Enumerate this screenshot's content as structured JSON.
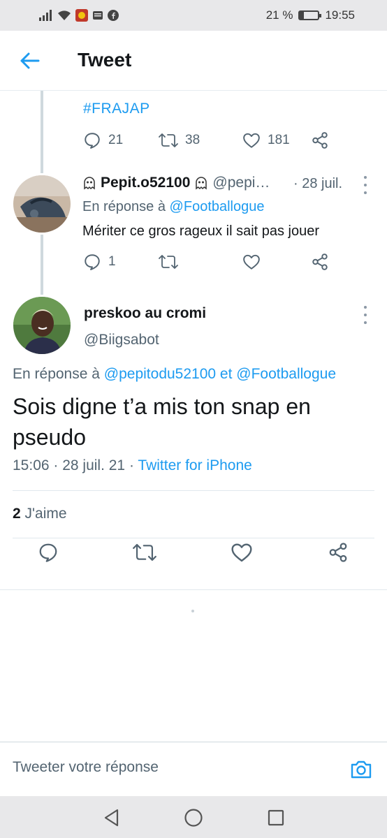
{
  "status_bar": {
    "battery_text": "21 %",
    "time": "19:55",
    "battery_level": 0.21
  },
  "header": {
    "title": "Tweet",
    "back_icon": "arrow-left-icon"
  },
  "parent_tweet": {
    "hashtag": "#FRAJAP",
    "replies": "21",
    "retweets": "38",
    "likes": "181"
  },
  "reply_tweet": {
    "name": "Pepit.o52100",
    "handle": "@pepi…",
    "date": "· 28 juil.",
    "reply_prefix": "En réponse à",
    "reply_to": "@Footballogue",
    "text": "Mériter ce gros rageux il sait pas jouer",
    "replies": "1"
  },
  "main_tweet": {
    "name": "preskoo au cromi",
    "handle": "@Biigsabot",
    "reply_prefix": "En réponse à",
    "reply_to_1": "@pepitodu52100",
    "reply_and": "et",
    "reply_to_2": "@Footballogue",
    "text": "Sois digne t’a mis ton snap en pseudo",
    "timestamp": "15:06 · 28 juil. 21 ·",
    "source": "Twitter for iPhone",
    "likes_count": "2",
    "likes_label": "J'aime"
  },
  "compose": {
    "placeholder": "Tweeter votre réponse"
  },
  "colors": {
    "accent": "#1d9bf0",
    "secondary_text": "#536471",
    "primary_text": "#14171a"
  }
}
